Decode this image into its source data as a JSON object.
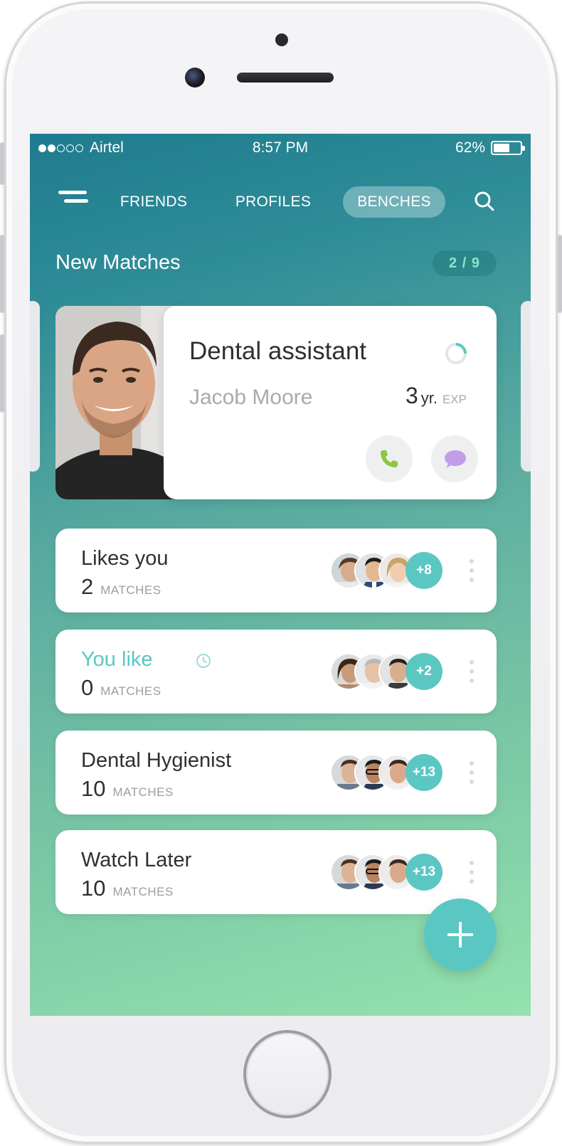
{
  "status_bar": {
    "carrier": "Airtel",
    "time": "8:57 PM",
    "battery": "62%",
    "battery_level": 0.62,
    "signal_bars_filled": 2,
    "signal_bars_total": 5
  },
  "nav": {
    "tabs": [
      {
        "label": "FRIENDS",
        "active": false
      },
      {
        "label": "PROFILES",
        "active": false
      },
      {
        "label": "BENCHES",
        "active": true
      }
    ],
    "menu_icon": "hamburger-icon",
    "search_icon": "search-icon"
  },
  "new_matches": {
    "title": "New Matches",
    "pager": "2 / 9",
    "card": {
      "job_title": "Dental assistant",
      "name": "Jacob Moore",
      "experience_number": "3",
      "experience_unit": "yr.",
      "experience_tag": "EXP",
      "call_icon": "phone-icon",
      "chat_icon": "chat-bubble-icon"
    }
  },
  "lists": [
    {
      "title": "Likes you",
      "count": "2",
      "count_label": "MATCHES",
      "more": "+8",
      "highlight": false
    },
    {
      "title": "You like",
      "count": "0",
      "count_label": "MATCHES",
      "more": "+2",
      "highlight": true
    },
    {
      "title": "Dental Hygienist",
      "count": "10",
      "count_label": "MATCHES",
      "more": "+13",
      "highlight": false
    },
    {
      "title": "Watch Later",
      "count": "10",
      "count_label": "MATCHES",
      "more": "+13",
      "highlight": false
    }
  ],
  "fab_icon": "plus-icon",
  "colors": {
    "accent": "#5bc7c3",
    "gradient_top": "#1f7b8f",
    "gradient_bottom": "#94e2ad",
    "call_green": "#8cc63f",
    "chat_purple": "#c19ee8"
  }
}
